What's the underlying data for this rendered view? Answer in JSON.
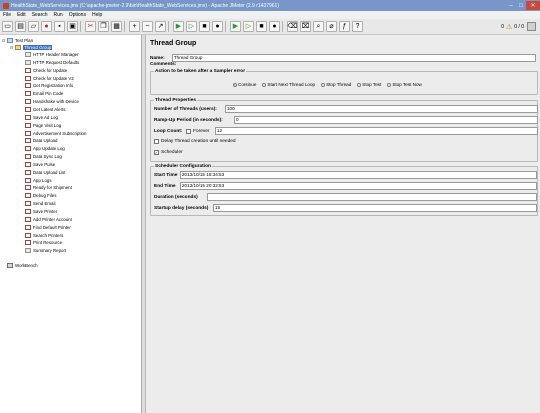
{
  "titlebar": {
    "title": "HealthState_WebServices.jmx (C:\\apache-jmeter-2.9\\bin\\HealthState_WebServices.jmx) - Apache JMeter (2.9 r1437961)",
    "minimize": "–",
    "maximize": "□",
    "close": "✕"
  },
  "menu": [
    "File",
    "Edit",
    "Search",
    "Run",
    "Options",
    "Help"
  ],
  "status": {
    "warnings": "0",
    "threads": "0 / 0"
  },
  "tree": {
    "test_plan": "Test Plan",
    "thread_group": "Thread Group",
    "children": [
      "HTTP Header Manager",
      "HTTP Request Defaults",
      "Check for Update",
      "Check for Update V2",
      "Get Registration Info",
      "Email Pin Code",
      "Handshake with Device",
      "Get Latest Alerts",
      "Save Ad Log",
      "Page Visit Log",
      "Advertisement Subscription",
      "Data Upload",
      "App Update Log",
      "Data Sync Log",
      "Save Pulse",
      "Data Upload List",
      "App Logs",
      "Ready for Shipment",
      "Debug Files",
      "Send Email",
      "Save Printer",
      "Add Printer Account",
      "Find Default Printer",
      "Search Printers",
      "Print Resource",
      "Summary Report"
    ],
    "workbench": "WorkBench"
  },
  "panel": {
    "title": "Thread Group",
    "name_label": "Name:",
    "name_value": "Thread Group",
    "comments_label": "Comments:",
    "action": {
      "legend": "Action to be taken after a Sampler error",
      "options": [
        "Continue",
        "Start Next Thread Loop",
        "Stop Thread",
        "Stop Test",
        "Stop Test Now"
      ],
      "selected": "Continue"
    },
    "props": {
      "legend": "Thread Properties",
      "threads_label": "Number of Threads (users):",
      "threads_value": "100",
      "ramp_label": "Ramp-Up Period (in seconds):",
      "ramp_value": "0",
      "loop_label": "Loop Count:",
      "forever_label": "Forever",
      "loop_value": "12",
      "delay_label": "Delay Thread creation until needed",
      "scheduler_label": "Scheduler"
    },
    "scheduler": {
      "legend": "Scheduler Configuration",
      "start_label": "Start Time",
      "start_value": "2013/10/15 18:34:53",
      "end_label": "End Time",
      "end_value": "2013/10/15 20:32:53",
      "duration_label": "Duration (seconds)",
      "duration_value": "",
      "startup_label": "Startup delay (seconds)",
      "startup_value": "15"
    }
  }
}
